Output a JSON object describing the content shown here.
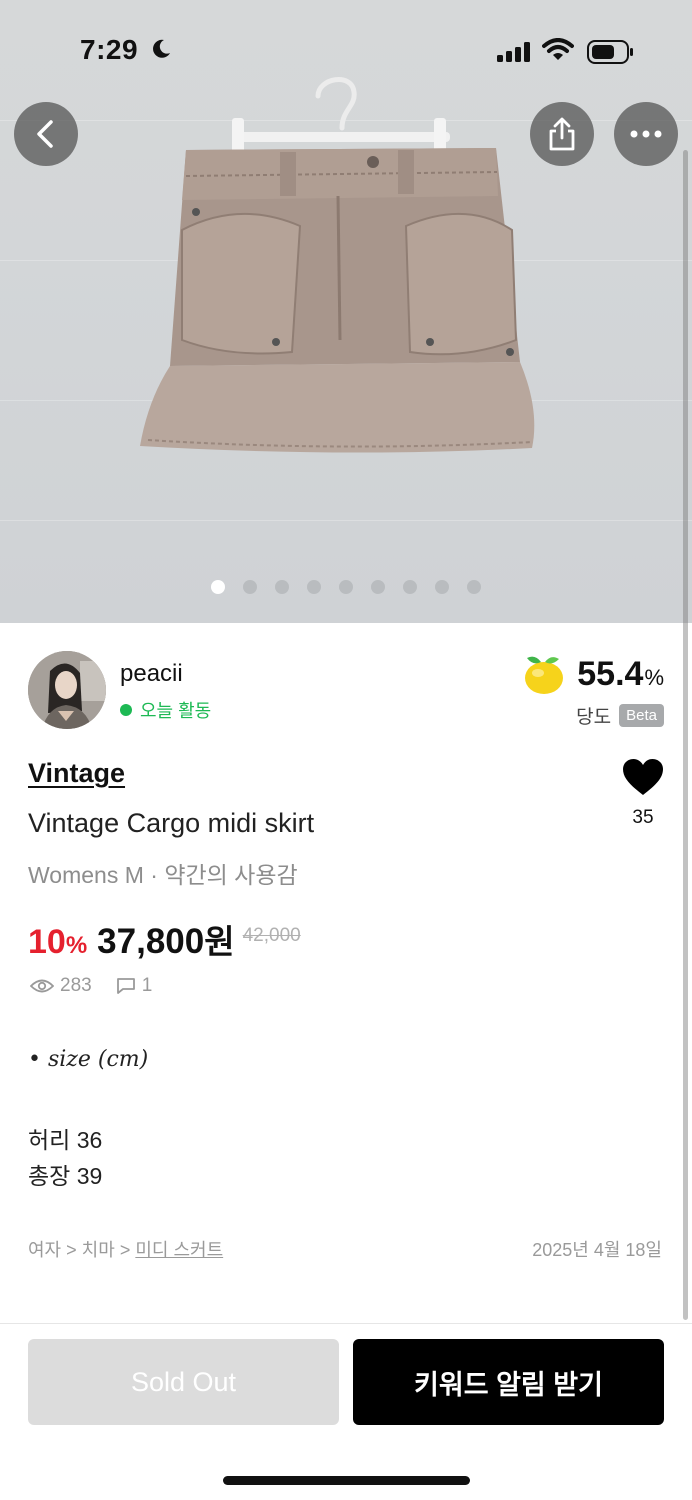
{
  "status_bar": {
    "time": "7:29"
  },
  "carousel": {
    "total": 9,
    "active_index": 0
  },
  "seller": {
    "name": "peacii",
    "activity": "오늘 활동",
    "sweetness_value": "55.4",
    "sweetness_unit": "%",
    "sweetness_label": "당도",
    "beta_badge": "Beta"
  },
  "product": {
    "brand": "Vintage",
    "title": "Vintage Cargo midi skirt",
    "subline": "Womens M · 약간의 사용감",
    "discount": "10",
    "discount_unit": "%",
    "price": "37,800",
    "price_unit": "원",
    "original_price": "42,000",
    "views": "283",
    "comments": "1",
    "likes": "35"
  },
  "description": {
    "bullet": "• size (cm)",
    "waist": "허리 36",
    "length": "총장 39"
  },
  "category": {
    "level1": "여자",
    "level2": "치마",
    "level3": "미디 스커트",
    "separator": ">"
  },
  "date": "2025년 4월 18일",
  "buttons": {
    "sold_out": "Sold Out",
    "keyword_alert": "키워드 알림 받기"
  },
  "colors": {
    "accent_red": "#e5202e",
    "active_green": "#1db954",
    "primary_black": "#000000",
    "disabled_gray": "#dcdcdc"
  }
}
